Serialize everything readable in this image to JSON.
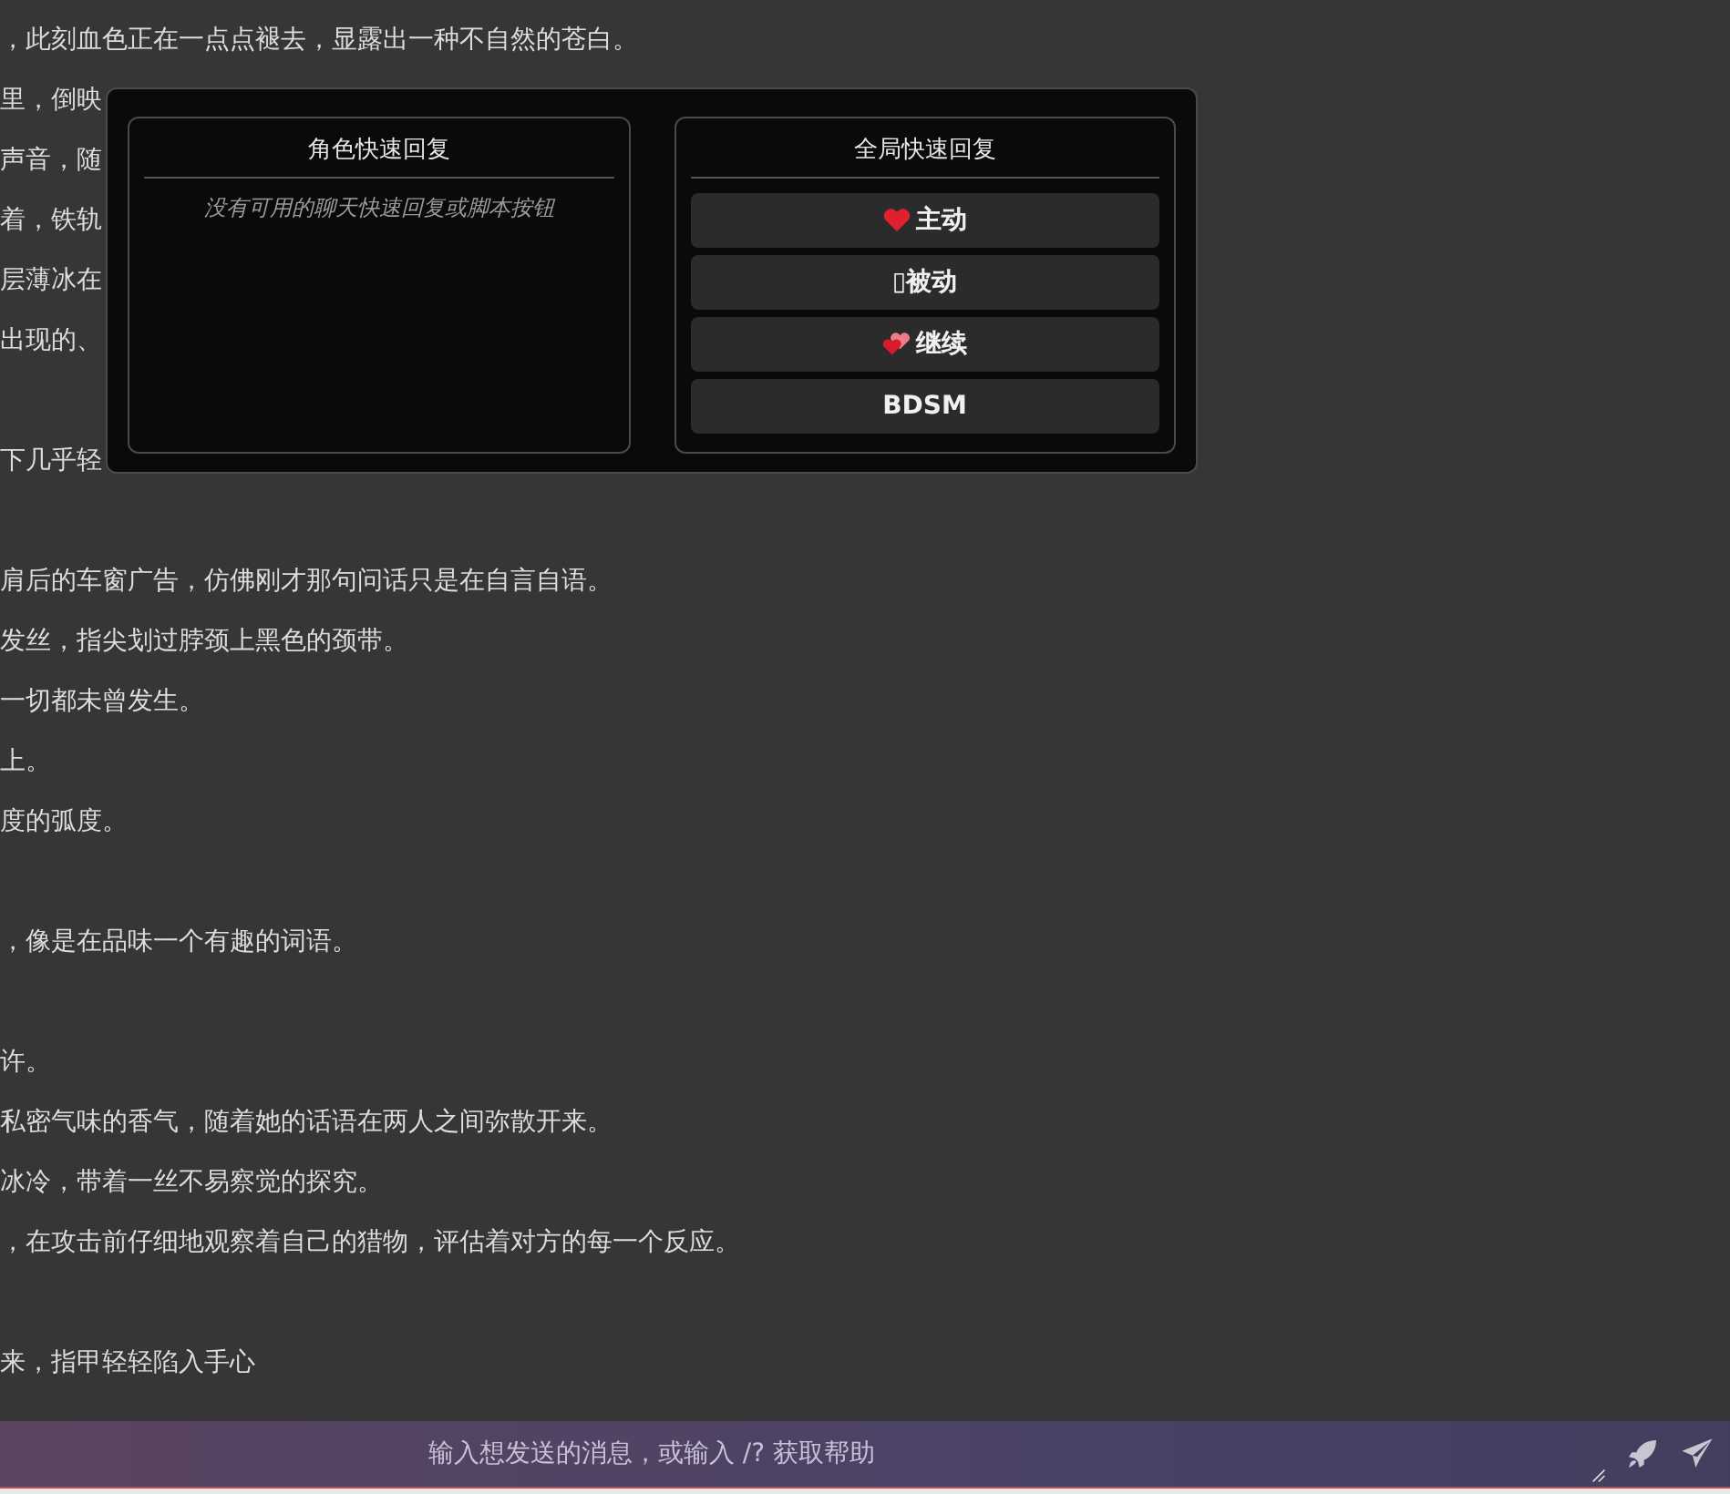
{
  "chat_paragraphs": [
    {
      "lines": [
        "，此刻血色正在一点点褪去，显露出一种不自然的苍白。",
        "里，倒映",
        "声音，随",
        "着，铁轨",
        "层薄冰在",
        "出现的、"
      ]
    },
    {
      "lines": [
        "下几乎轻"
      ]
    },
    {
      "lines": [
        "肩后的车窗广告，仿佛刚才那句问话只是在自言自语。",
        "发丝，指尖划过脖颈上黑色的颈带。",
        "一切都未曾发生。",
        "上。",
        "度的弧度。"
      ]
    },
    {
      "lines": [
        "，像是在品味一个有趣的词语。"
      ]
    },
    {
      "lines": [
        "许。",
        "私密气味的香气，随着她的话语在两人之间弥散开来。",
        "冰冷，带着一丝不易察觉的探究。",
        "，在攻击前仔细地观察着自己的猎物，评估着对方的每一个反应。"
      ]
    },
    {
      "lines": [
        "来，指甲轻轻陷入手心"
      ]
    }
  ],
  "quick_reply": {
    "character_panel": {
      "title": "角色快速回复",
      "empty_note": "没有可用的聊天快速回复或脚本按钮"
    },
    "global_panel": {
      "title": "全局快速回复",
      "buttons": [
        {
          "label": "主动",
          "kind": "heart"
        },
        {
          "label": "▯被动",
          "kind": "plain"
        },
        {
          "label": "继续",
          "kind": "hearts"
        },
        {
          "label": "BDSM",
          "kind": "plain"
        }
      ]
    }
  },
  "input": {
    "placeholder": "输入想发送的消息，或输入 /? 获取帮助"
  }
}
